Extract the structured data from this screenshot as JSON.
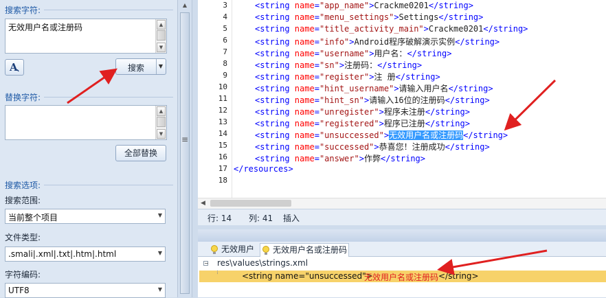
{
  "left_panel": {
    "search_section_label": "搜索字符:",
    "search_value": "无效用户名或注册码",
    "font_button_icon": "text-style-icon",
    "search_button_label": "搜索",
    "replace_section_label": "替换字符:",
    "replace_value": "",
    "replace_all_button_label": "全部替换",
    "options_section_label": "搜索选项:",
    "scope_label": "搜索范围:",
    "scope_value": "当前整个项目",
    "filetype_label": "文件类型:",
    "filetype_value": ".smali|.xml|.txt|.htm|.html",
    "encoding_label": "字符编码:",
    "encoding_value": "UTF8"
  },
  "splitter": {
    "grip": "≡"
  },
  "editor": {
    "line_numbers": [
      "3",
      "4",
      "5",
      "6",
      "7",
      "8",
      "9",
      "10",
      "11",
      "12",
      "13",
      "14",
      "15",
      "16",
      "17",
      "18"
    ],
    "lines": [
      {
        "name": "app_name",
        "value": "Crackme0201"
      },
      {
        "name": "menu_settings",
        "value": "Settings"
      },
      {
        "name": "title_activity_main",
        "value": "Crackme0201"
      },
      {
        "name": "info",
        "value": "Android程序破解演示实例"
      },
      {
        "name": "username",
        "value": "用户名："
      },
      {
        "name": "sn",
        "value": "注册码："
      },
      {
        "name": "register",
        "value": "注 册"
      },
      {
        "name": "hint_username",
        "value": "请输入用户名"
      },
      {
        "name": "hint_sn",
        "value": "请输入16位的注册码"
      },
      {
        "name": "unregister",
        "value": "程序未注册"
      },
      {
        "name": "registered",
        "value": "程序已注册"
      },
      {
        "name": "unsuccessed",
        "value": "无效用户名或注册码"
      },
      {
        "name": "successed",
        "value": "恭喜您！注册成功"
      },
      {
        "name": "answer",
        "value": "作弊"
      }
    ],
    "closing_tag": "</resources>",
    "open_tag": "<string name=",
    "close_tag": "</string>"
  },
  "status_bar": {
    "row": "行: 14",
    "col": "列: 41",
    "mode": "插入"
  },
  "results": {
    "tab1_label": "无效用户",
    "tab2_label": "无效用户名或注册码",
    "tree_icon": "collapse-minus-icon",
    "file_path": "res\\values\\strings.xml",
    "match_prefix": "<string name=\"unsuccessed\">",
    "match_text": "无效用户名或注册码",
    "match_suffix": " </string>"
  },
  "colors": {
    "tag": "#0000ff",
    "attribute": "#ff0000",
    "value": "#a31515",
    "selection": "#3399ff",
    "result_highlight": "#f7d26a",
    "annotation_arrow": "#e02020"
  }
}
